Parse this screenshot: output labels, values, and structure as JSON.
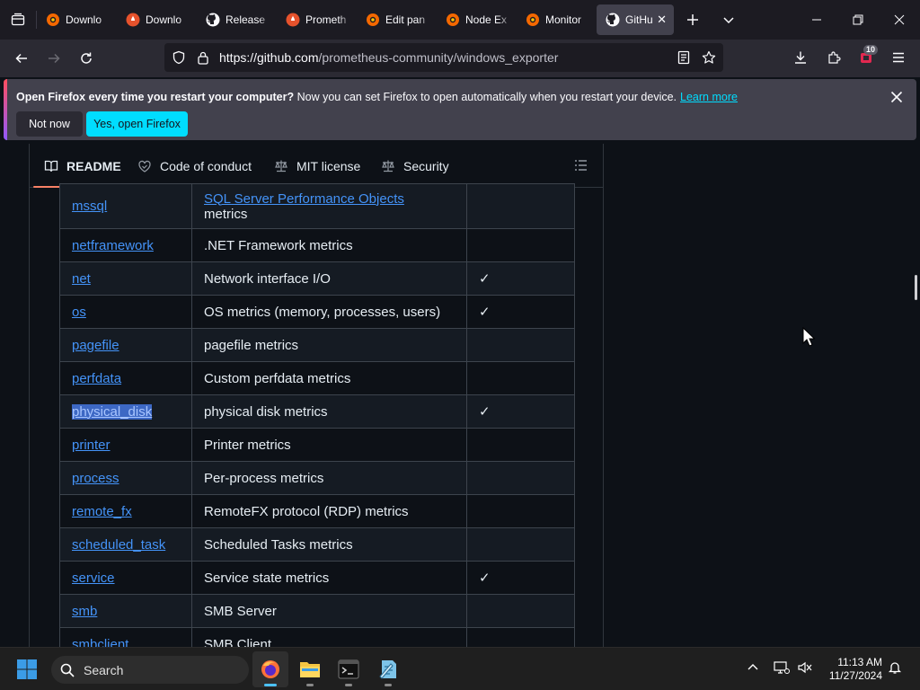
{
  "browser": {
    "tabs": [
      {
        "label": "Downlo",
        "icon": "grafana-icon"
      },
      {
        "label": "Downlo",
        "icon": "prometheus-icon"
      },
      {
        "label": "Release",
        "icon": "github-icon"
      },
      {
        "label": "Prometh",
        "icon": "prometheus-icon"
      },
      {
        "label": "Edit pan",
        "icon": "grafana-icon"
      },
      {
        "label": "Node Ex",
        "icon": "grafana-icon"
      },
      {
        "label": "Monitor",
        "icon": "grafana-icon"
      },
      {
        "label": "GitHu",
        "icon": "github-icon",
        "active": true
      }
    ],
    "url_host": "https://github.com",
    "url_path": "/prometheus-community/windows_exporter",
    "extensions_badge": "10"
  },
  "notification": {
    "title": "Open Firefox every time you restart your computer?",
    "message": " Now you can set Firefox to open automatically when you restart your device.",
    "link": "Learn more",
    "not_now": "Not now",
    "yes": "Yes, open Firefox"
  },
  "readme_nav": {
    "readme": "README",
    "code_of_conduct": "Code of conduct",
    "license": "MIT license",
    "security": "Security"
  },
  "collectors": [
    {
      "name": "mssql",
      "desc_link": "SQL Server Performance Objects",
      "desc": "metrics",
      "default": ""
    },
    {
      "name": "netframework",
      "desc": ".NET Framework metrics",
      "default": ""
    },
    {
      "name": "net",
      "desc": "Network interface I/O",
      "default": "✓"
    },
    {
      "name": "os",
      "desc": "OS metrics (memory, processes, users)",
      "default": "✓"
    },
    {
      "name": "pagefile",
      "desc": "pagefile metrics",
      "default": ""
    },
    {
      "name": "perfdata",
      "desc": "Custom perfdata metrics",
      "default": ""
    },
    {
      "name": "physical_disk",
      "desc": "physical disk metrics",
      "default": "✓",
      "selected": true
    },
    {
      "name": "printer",
      "desc": "Printer metrics",
      "default": ""
    },
    {
      "name": "process",
      "desc": "Per-process metrics",
      "default": ""
    },
    {
      "name": "remote_fx",
      "desc": "RemoteFX protocol (RDP) metrics",
      "default": ""
    },
    {
      "name": "scheduled_task",
      "desc": "Scheduled Tasks metrics",
      "default": ""
    },
    {
      "name": "service",
      "desc": "Service state metrics",
      "default": "✓"
    },
    {
      "name": "smb",
      "desc": "SMB Server",
      "default": ""
    },
    {
      "name": "smbclient",
      "desc": "SMB Client",
      "default": ""
    }
  ],
  "taskbar": {
    "search": "Search",
    "time": "11:13 AM",
    "date": "11/27/2024"
  },
  "colors": {
    "accent": "#00ddff",
    "link": "#4493f8",
    "tab_underline": "#f78166"
  }
}
